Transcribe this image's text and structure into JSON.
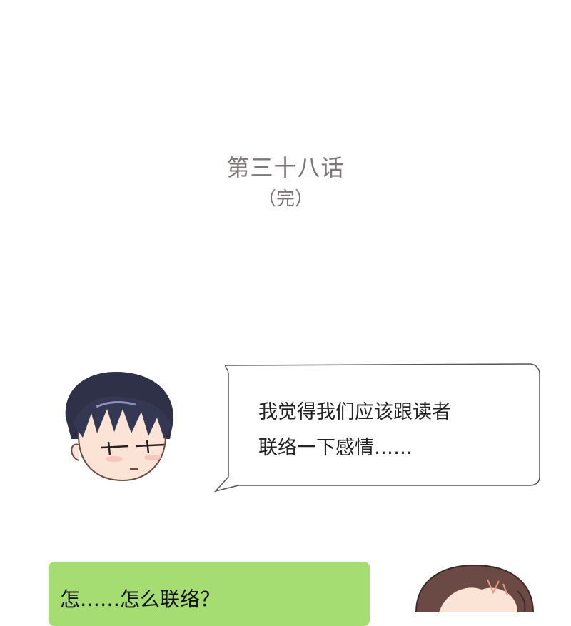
{
  "chapter": {
    "title": "第三十八话",
    "status": "（完）"
  },
  "boy_speech": {
    "line1": "我觉得我们应该跟读者",
    "line2": "联络一下感情……"
  },
  "girl_reply": {
    "text": "怎……怎么联络？"
  },
  "colors": {
    "title_gray": "#7d7676",
    "reply_green": "#a6dd73",
    "hair_navy": "#2f3148"
  }
}
